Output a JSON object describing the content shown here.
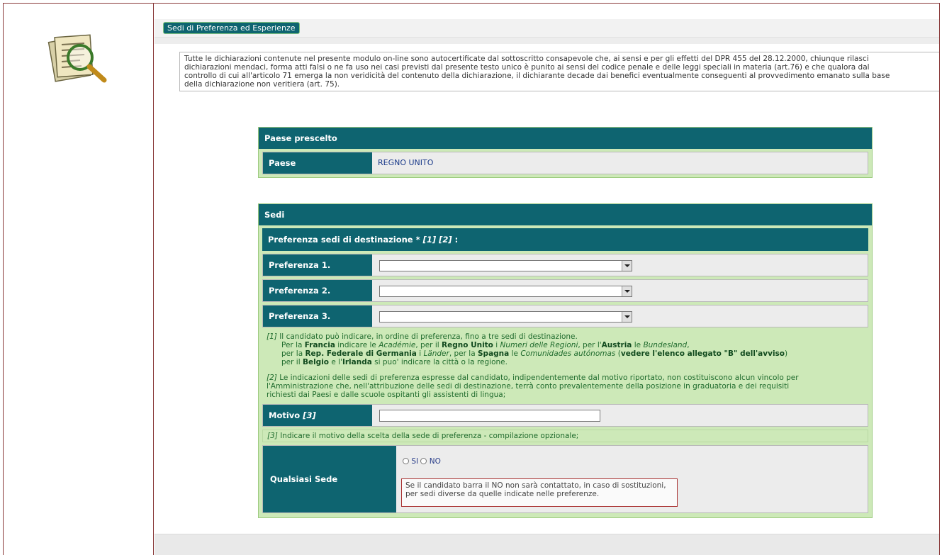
{
  "section_tab": "Sedi di Preferenza ed Esperienze",
  "notice": [
    "Tutte le dichiarazioni contenute nel presente modulo on-line sono autocertificate dal sottoscritto consapevole che, ai sensi e per gli effetti del DPR 455 del 28.12.2000, chiunque rilasci",
    "dichiarazioni mendaci, forma atti falsi o ne fa uso nei casi previsti dal presente testo unico è punito ai sensi del codice penale e delle leggi speciali in materia (art.76) e che qualora dal",
    "controllo di cui all'articolo 71 emerga la non veridicità del contenuto della dichiarazione, il dichiarante decade dai benefici eventualmente conseguenti al provvedimento emanato sulla base",
    "della dichiarazione non veritiera (art. 75)."
  ],
  "paese_panel": {
    "title": "Paese prescelto",
    "label": "Paese",
    "value": "REGNO UNITO"
  },
  "sedi_panel": {
    "title": "Sedi",
    "subheader_text": "Preferenza sedi di destinazione * ",
    "subheader_refs": "[1] [2]",
    "subheader_colon": " :",
    "preferences": [
      {
        "label": "Preferenza 1.",
        "value": ""
      },
      {
        "label": "Preferenza 2.",
        "value": ""
      },
      {
        "label": "Preferenza 3.",
        "value": ""
      }
    ],
    "note1": {
      "ref": "[1]",
      "a": " Il candidato può indicare, in ordine di preferenza, fino a tre sedi di destinazione.",
      "b1": "Per la ",
      "b2": "Francia",
      "b3": " indicare le ",
      "b4": "Académie",
      "b5": ", per il ",
      "b6": "Regno Unito",
      "b7": " i ",
      "b8": "Numeri delle Regioni",
      "b9": ", per l'",
      "b10": "Austria",
      "b11": " le ",
      "b12": "Bundesland",
      "b13": ",",
      "c1": "per la ",
      "c2": "Rep. Federale di Germania",
      "c3": " i ",
      "c4": "Länder",
      "c5": ", per la ",
      "c6": "Spagna",
      "c7": " le ",
      "c8": "Comunidades autónomas",
      "c9": " (",
      "c10": "vedere l'elenco allegato \"B\" dell'avviso",
      "c11": ")",
      "d1": "per il ",
      "d2": "Belgio",
      "d3": " e l'",
      "d4": "Irlanda",
      "d5": " si puo' indicare la città o la regione."
    },
    "note2": {
      "ref": "[2]",
      "l1": " Le indicazioni delle sedi di preferenza espresse dal candidato, indipendentemente dal motivo riportato, non costituiscono alcun vincolo per",
      "l2": "l'Amministrazione che, nell'attribuzione delle sedi di destinazione, terrà conto prevalentemente della posizione in graduatoria e dei requisiti",
      "l3": "richiesti dai Paesi e dalle scuole ospitanti gli assistenti di lingua;"
    },
    "motivo_label": "Motivo ",
    "motivo_ref": "[3]",
    "motivo_value": "",
    "note3_ref": "[3]",
    "note3_text": " Indicare il motivo della scelta della sede di preferenza - compilazione opzionale;",
    "qualsiasi_label": "Qualsiasi Sede",
    "radio_si": "SI",
    "radio_no": "NO",
    "warning_l1": "Se il candidato barra il NO non sarà contattato, in caso di sostituzioni,",
    "warning_l2": "per sedi diverse da quelle indicate nelle preferenze."
  }
}
